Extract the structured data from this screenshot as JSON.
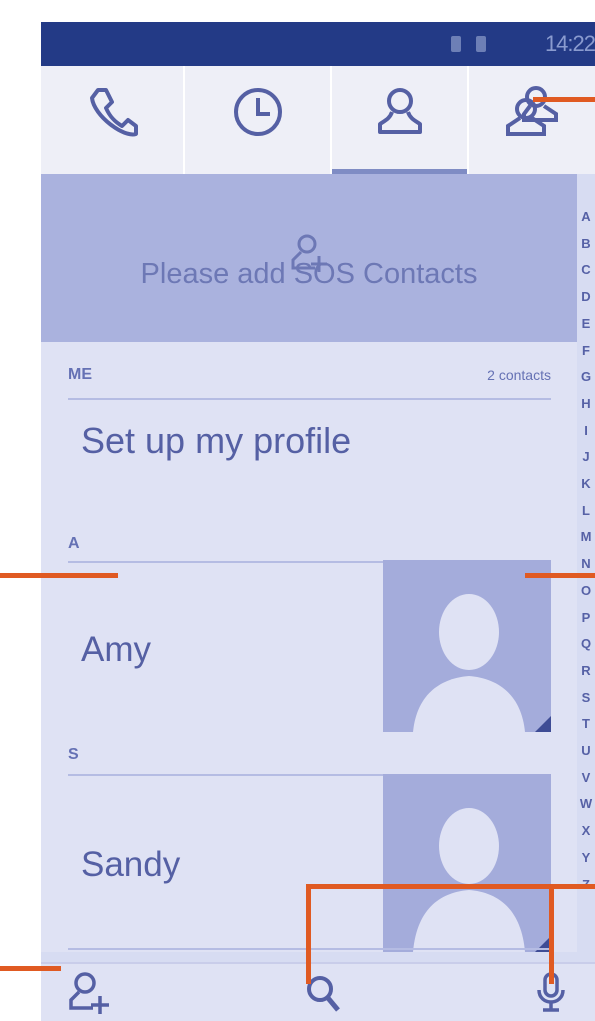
{
  "status_bar": {
    "time": "14:22"
  },
  "tabs": [
    {
      "icon": "phone-icon",
      "label": "Phone"
    },
    {
      "icon": "clock-icon",
      "label": "Call log"
    },
    {
      "icon": "person-icon",
      "label": "Contacts",
      "selected": true
    },
    {
      "icon": "group-icon",
      "label": "Groups"
    }
  ],
  "sos": {
    "label": "Please add SOS Contacts",
    "icon": "add-person-icon"
  },
  "me_section": {
    "header": "ME",
    "count": "2 contacts"
  },
  "profile": {
    "label": "Set up my profile"
  },
  "contacts": [
    {
      "section": "A",
      "name": "Amy",
      "avatar": "default-avatar-icon"
    },
    {
      "section": "S",
      "name": "Sandy",
      "avatar": "default-avatar-icon"
    }
  ],
  "alphabet": [
    "A",
    "B",
    "C",
    "D",
    "E",
    "F",
    "G",
    "H",
    "I",
    "J",
    "K",
    "L",
    "M",
    "N",
    "O",
    "P",
    "Q",
    "R",
    "S",
    "T",
    "U",
    "V",
    "W",
    "X",
    "Y",
    "Z"
  ],
  "bottom_bar": {
    "add_contact_icon": "add-person-icon",
    "search_icon": "search-icon",
    "menu_icon": "voice-icon"
  },
  "colors": {
    "accent": "#e05a22",
    "statusbar": "#233a86",
    "primary_text": "#5560a4"
  }
}
